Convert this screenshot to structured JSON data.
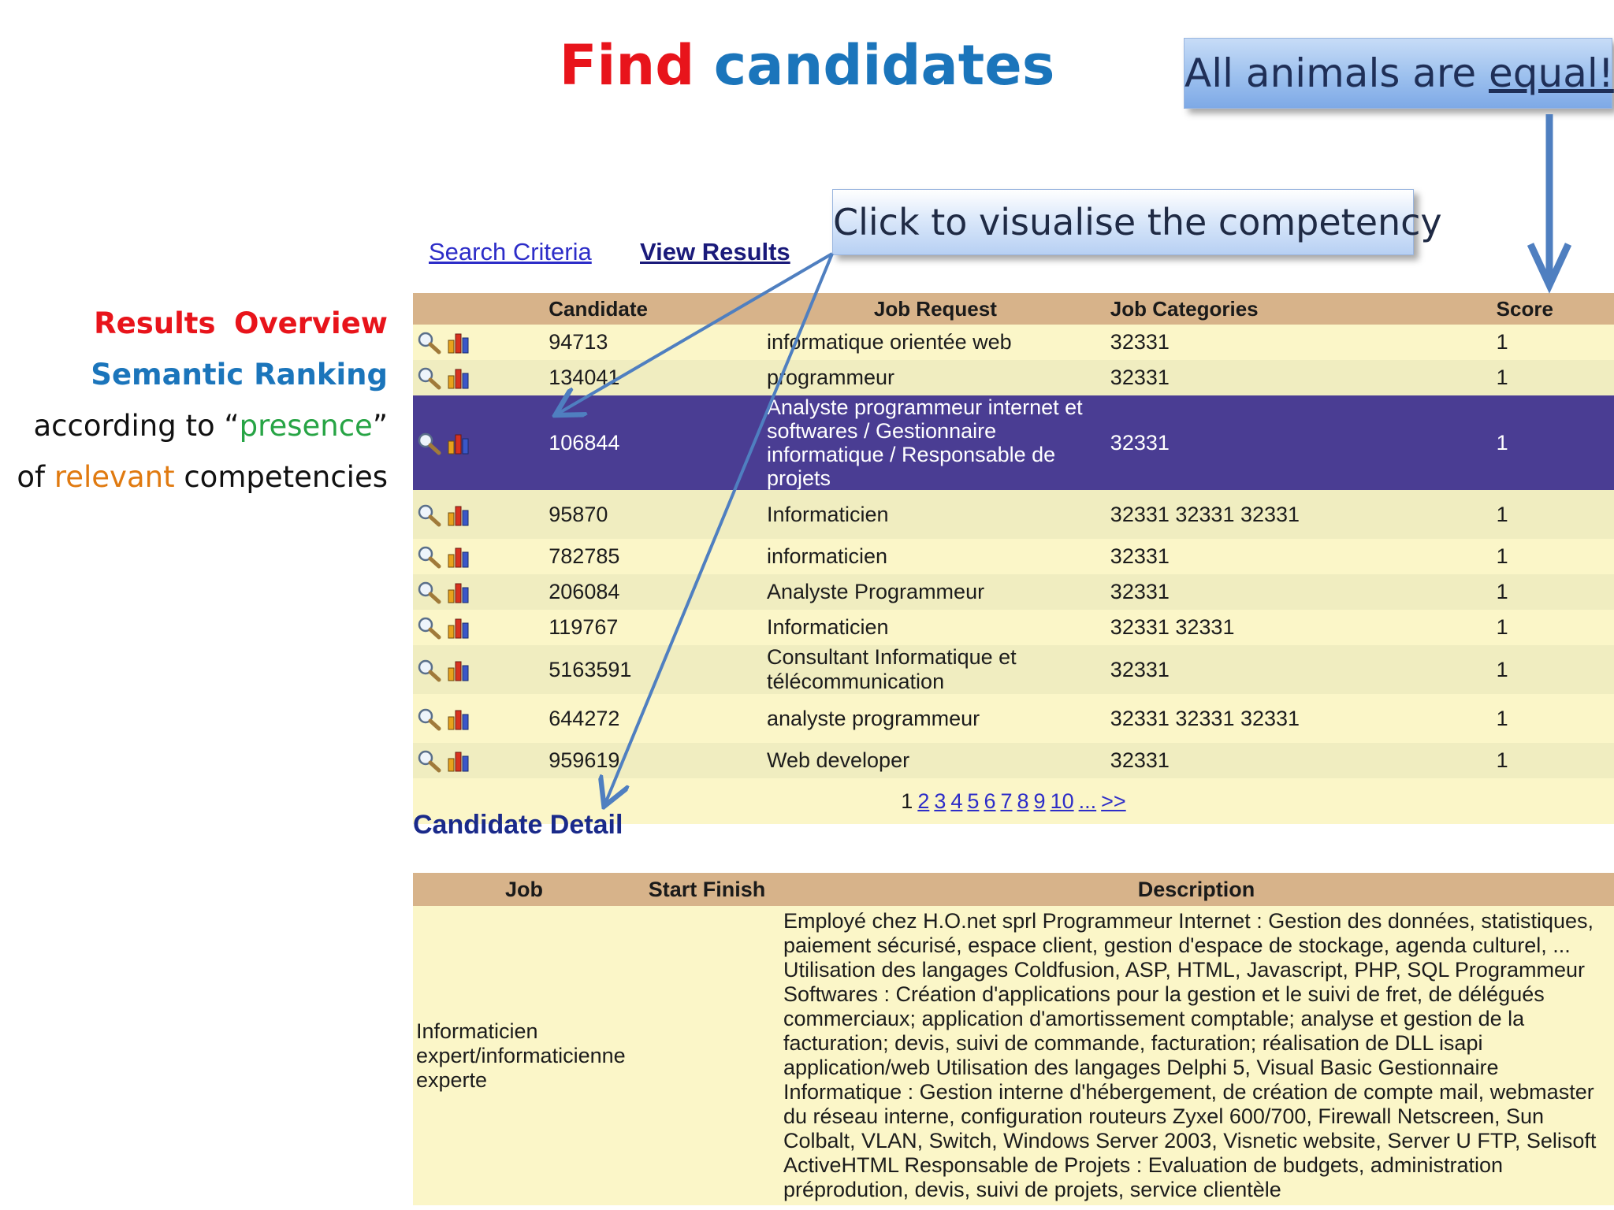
{
  "title": {
    "part1": "Find",
    "part2": "candidates"
  },
  "callouts": {
    "animals_prefix": "All animals are ",
    "animals_underlined": "equal!",
    "click": "Click to visualise the competency"
  },
  "caption": {
    "line1_a": "Results",
    "line1_b": "Overview",
    "line2": "Semantic Ranking",
    "line3_a": "according to “",
    "line3_b": "presence",
    "line3_c": "”",
    "line4_a": "of ",
    "line4_b": "relevant",
    "line4_c": " competencies"
  },
  "nav": {
    "search": "Search Criteria",
    "view": "View Results"
  },
  "results": {
    "headers": {
      "candidate": "Candidate",
      "job": "Job Request",
      "categories": "Job Categories",
      "score": "Score"
    },
    "rows": [
      {
        "id": "94713",
        "job": "informatique orientée web",
        "cat": "32331",
        "score": "1"
      },
      {
        "id": "134041",
        "job": "programmeur",
        "cat": "32331",
        "score": "1"
      },
      {
        "id": "106844",
        "job": "Analyste programmeur internet et softwares / Gestionnaire informatique / Responsable de projets",
        "cat": "32331",
        "score": "1"
      },
      {
        "id": "95870",
        "job": "Informaticien",
        "cat": "32331 32331 32331",
        "score": "1"
      },
      {
        "id": "782785",
        "job": "informaticien",
        "cat": "32331",
        "score": "1"
      },
      {
        "id": "206084",
        "job": "Analyste Programmeur",
        "cat": "32331",
        "score": "1"
      },
      {
        "id": "119767",
        "job": "Informaticien",
        "cat": "32331 32331",
        "score": "1"
      },
      {
        "id": "5163591",
        "job": "Consultant Informatique et télécommunication",
        "cat": "32331",
        "score": "1"
      },
      {
        "id": "644272",
        "job": "analyste programmeur",
        "cat": "32331 32331 32331",
        "score": "1"
      },
      {
        "id": "959619",
        "job": "Web developer",
        "cat": "32331",
        "score": "1"
      }
    ],
    "pager": [
      "1",
      "2",
      "3",
      "4",
      "5",
      "6",
      "7",
      "8",
      "9",
      "10",
      "...",
      ">>"
    ]
  },
  "detail": {
    "title": "Candidate Detail",
    "headers": {
      "job": "Job",
      "start_finish": "Start Finish",
      "description": "Description"
    },
    "job": "Informaticien expert/informaticienne experte",
    "description": "Employé chez H.O.net sprl Programmeur Internet : Gestion des données, statistiques, paiement sécurisé, espace client, gestion d'espace de stockage, agenda culturel, ... Utilisation des langages Coldfusion, ASP, HTML, Javascript, PHP, SQL Programmeur Softwares : Création d'applications pour la gestion et le suivi de fret, de délégués commerciaux; application d'amortissement comptable; analyse et gestion de la facturation; devis, suivi de commande, facturation; réalisation de DLL isapi application/web Utilisation des langages Delphi 5, Visual Basic Gestionnaire Informatique : Gestion interne d'hébergement, de création de compte mail, webmaster du réseau interne, configuration routeurs Zyxel 600/700, Firewall Netscreen, Sun Colbalt, VLAN, Switch, Windows Server 2003, Visnetic website, Server U FTP, Selisoft ActiveHTML Responsable de Projets : Evaluation de budgets, administration préprodution, devis, suivi de projets, service clientèle"
  },
  "colors": {
    "title_red": "#e8141b",
    "title_blue": "#1b75bb",
    "header_tan": "#d7b38a",
    "row_cream": "#fbf6c8",
    "row_selected": "#4a3d93",
    "arrow_blue": "#4f7fc0"
  },
  "icons": {
    "view": "magnifier-icon",
    "chart": "bar-chart-icon"
  }
}
